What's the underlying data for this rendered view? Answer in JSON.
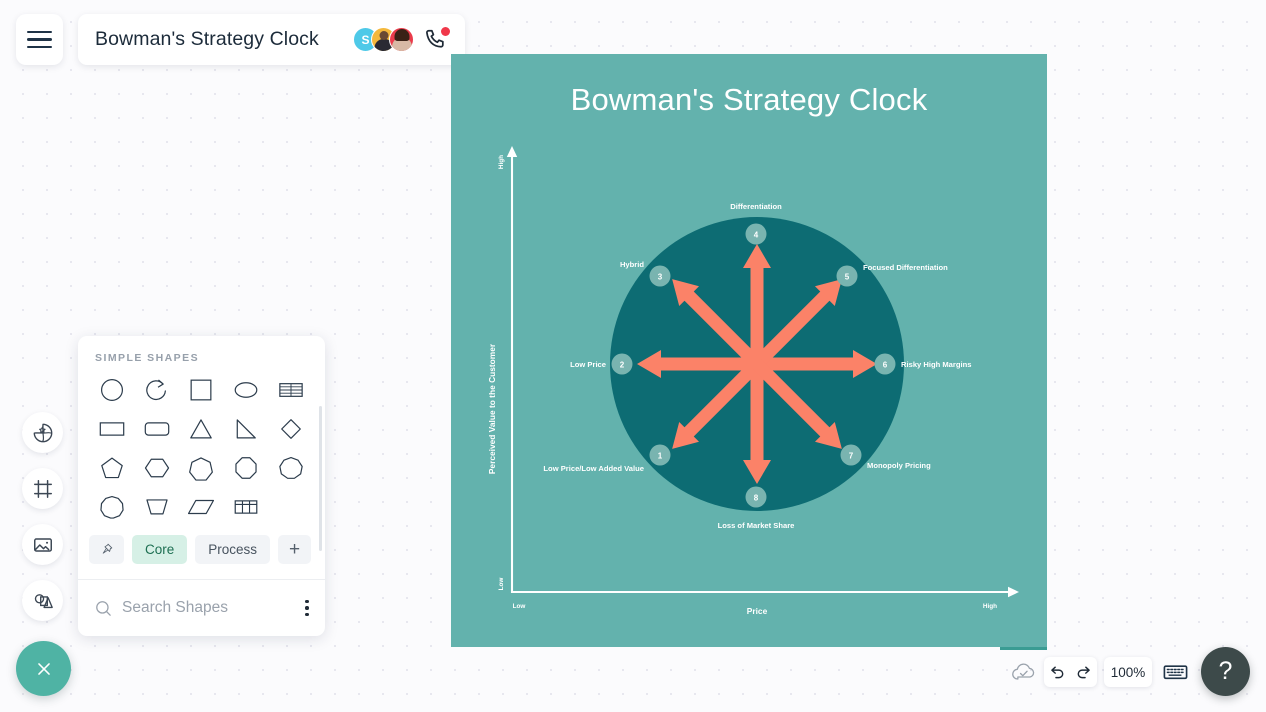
{
  "app": {
    "doc_title": "Bowman's Strategy Clock",
    "menu_icon": "hamburger-icon"
  },
  "collaborators": [
    {
      "initial": "S",
      "color": "#4ec9e8",
      "type": "initial"
    },
    {
      "initial": "",
      "color": "#f4b83c",
      "type": "photo"
    },
    {
      "initial": "",
      "color": "#ea3b4b",
      "type": "photo"
    }
  ],
  "call": {
    "icon": "phone-icon",
    "badge_color": "#f0384a"
  },
  "rail": {
    "items": [
      {
        "icon": "sticker-star-icon",
        "label": "Stickers"
      },
      {
        "icon": "frame-icon",
        "label": "Frames"
      },
      {
        "icon": "image-icon",
        "label": "Images"
      },
      {
        "icon": "shapes-icon",
        "label": "Shapes"
      }
    ],
    "close_icon": "close-icon",
    "close_color": "#4fb3a4"
  },
  "shapes_panel": {
    "heading": "SIMPLE SHAPES",
    "shapes": [
      "circle",
      "arc",
      "square",
      "ellipse",
      "table-striped",
      "rectangle",
      "rounded-rectangle",
      "triangle",
      "right-triangle",
      "diamond",
      "pentagon",
      "hexagon",
      "heptagon",
      "octagon",
      "nonagon",
      "decagon",
      "trapezoid",
      "parallelogram",
      "table-grid"
    ],
    "tabs": [
      {
        "label": "",
        "icon": "pin-icon",
        "active": false
      },
      {
        "label": "Core",
        "active": true
      },
      {
        "label": "Process",
        "active": false
      },
      {
        "label": "+",
        "active": false
      }
    ],
    "search_placeholder": "Search Shapes",
    "search_value": "",
    "search_icon": "search-icon",
    "more_icon": "kebab-menu-icon"
  },
  "statusbar": {
    "save_icon": "cloud-check-icon",
    "undo_icon": "undo-icon",
    "redo_icon": "redo-icon",
    "zoom_level": "100%",
    "keyboard_icon": "keyboard-icon",
    "help_label": "?"
  },
  "chart_data": {
    "type": "diagram",
    "title": "Bowman's Strategy Clock",
    "xlabel": "Price",
    "ylabel": "Perceived Value to the Customer",
    "x_ticks": [
      "Low",
      "High"
    ],
    "y_ticks": [
      "Low",
      "High"
    ],
    "colors": {
      "background": "#63b2ad",
      "circle": "#0d6c73",
      "arrow": "#fb8268",
      "badge": "#7fb9b3",
      "text": "#ffffff"
    },
    "positions": [
      {
        "number": "1",
        "label": "Low Price/Low Added Value",
        "angle_deg": 225,
        "label_side": "left"
      },
      {
        "number": "2",
        "label": "Low Price",
        "angle_deg": 180,
        "label_side": "left"
      },
      {
        "number": "3",
        "label": "Hybrid",
        "angle_deg": 135,
        "label_side": "left"
      },
      {
        "number": "4",
        "label": "Differentiation",
        "angle_deg": 90,
        "label_side": "top"
      },
      {
        "number": "5",
        "label": "Focused Differentiation",
        "angle_deg": 45,
        "label_side": "right"
      },
      {
        "number": "6",
        "label": "Risky High Margins",
        "angle_deg": 0,
        "label_side": "right"
      },
      {
        "number": "7",
        "label": "Monopoly Pricing",
        "angle_deg": 315,
        "label_side": "right"
      },
      {
        "number": "8",
        "label": "Loss of Market Share",
        "angle_deg": 270,
        "label_side": "bottom"
      }
    ]
  }
}
